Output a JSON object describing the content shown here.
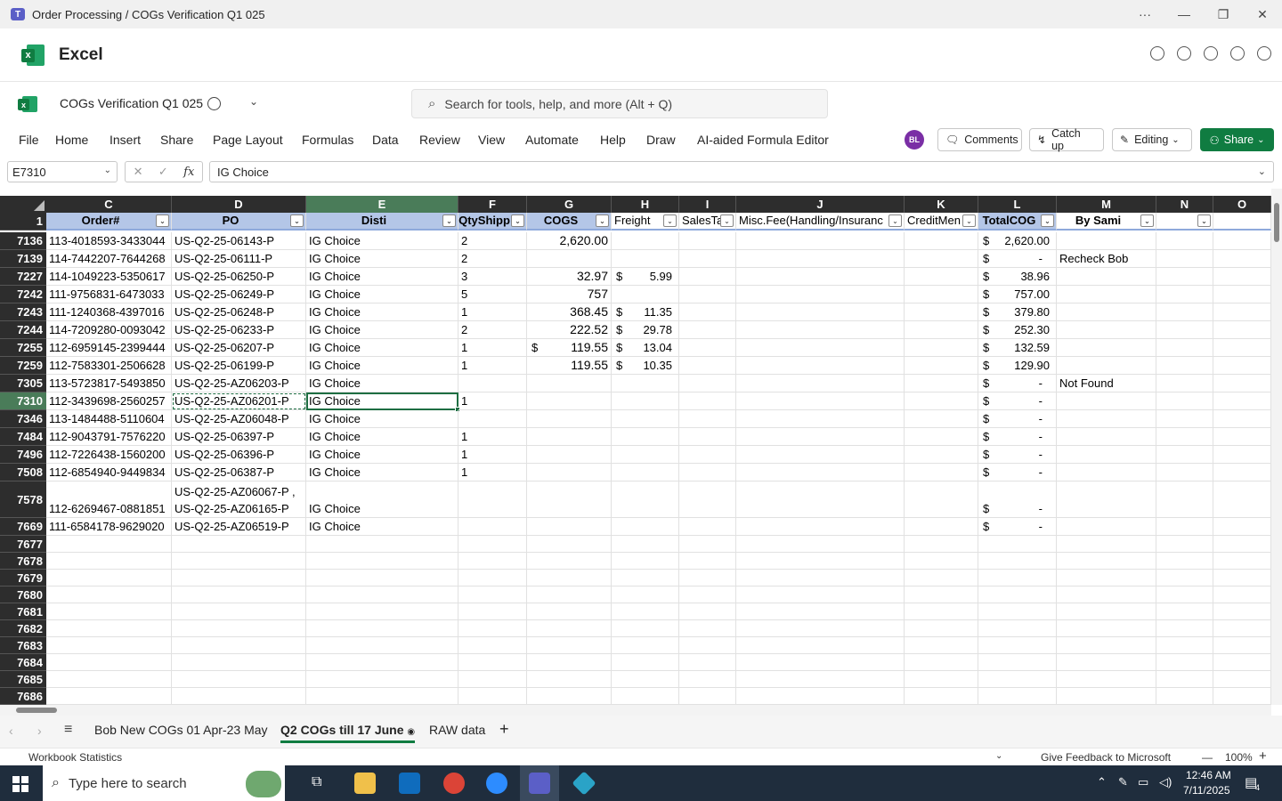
{
  "window": {
    "title": "Order Processing / COGs Verification Q1 025"
  },
  "app": {
    "name": "Excel"
  },
  "file": {
    "name": "COGs Verification Q1 025"
  },
  "search": {
    "placeholder": "Search for tools, help, and more (Alt + Q)"
  },
  "ribbon": {
    "tabs": [
      "File",
      "Home",
      "Insert",
      "Share",
      "Page Layout",
      "Formulas",
      "Data",
      "Review",
      "View",
      "Automate",
      "Help",
      "Draw",
      "AI-aided Formula Editor"
    ],
    "avatar": "BL",
    "comments": "Comments",
    "catchup": "Catch up",
    "editing": "Editing",
    "share": "Share"
  },
  "formula_bar": {
    "name_box": "E7310",
    "value": "IG Choice"
  },
  "columns": [
    "C",
    "D",
    "E",
    "F",
    "G",
    "H",
    "I",
    "J",
    "K",
    "L",
    "M",
    "N",
    "O"
  ],
  "header_row": {
    "row_num": "1",
    "cells": [
      "Order#",
      "PO",
      "Disti",
      "QtyShipp",
      "COGS",
      "Freight",
      "SalesTa",
      "Misc.Fee(Handling/Insuranc",
      "CreditMen",
      "TotalCOG",
      "By Sami",
      "",
      ""
    ]
  },
  "rows": [
    {
      "num": "7136",
      "C": "113-4018593-3433044",
      "D": "US-Q2-25-06143-P",
      "E": "IG Choice",
      "F": "2",
      "G": "2,620.00",
      "G_dollar": "",
      "H": "",
      "L": "2,620.00",
      "M": ""
    },
    {
      "num": "7139",
      "C": "114-7442207-7644268",
      "D": "US-Q2-25-06111-P",
      "E": "IG Choice",
      "F": "2",
      "G": "",
      "G_dollar": "",
      "H": "",
      "L": "-",
      "M": "Recheck Bob"
    },
    {
      "num": "7227",
      "C": "114-1049223-5350617",
      "D": "US-Q2-25-06250-P",
      "E": "IG Choice",
      "F": "3",
      "G": "32.97",
      "G_dollar": "",
      "H": "5.99",
      "L": "38.96",
      "M": ""
    },
    {
      "num": "7242",
      "C": "111-9756831-6473033",
      "D": "US-Q2-25-06249-P",
      "E": "IG Choice",
      "F": "5",
      "G": "757",
      "G_dollar": "",
      "H": "",
      "L": "757.00",
      "M": ""
    },
    {
      "num": "7243",
      "C": "111-1240368-4397016",
      "D": "US-Q2-25-06248-P",
      "E": "IG Choice",
      "F": "1",
      "G": "368.45",
      "G_dollar": "",
      "H": "11.35",
      "L": "379.80",
      "M": ""
    },
    {
      "num": "7244",
      "C": "114-7209280-0093042",
      "D": "US-Q2-25-06233-P",
      "E": "IG Choice",
      "F": "2",
      "G": "222.52",
      "G_dollar": "",
      "H": "29.78",
      "L": "252.30",
      "M": ""
    },
    {
      "num": "7255",
      "C": "112-6959145-2399444",
      "D": "US-Q2-25-06207-P",
      "E": "IG Choice",
      "F": "1",
      "G": "119.55",
      "G_dollar": "$",
      "H": "13.04",
      "L": "132.59",
      "M": ""
    },
    {
      "num": "7259",
      "C": "112-7583301-2506628",
      "D": "US-Q2-25-06199-P",
      "E": "IG Choice",
      "F": "1",
      "G": "119.55",
      "G_dollar": "",
      "H": "10.35",
      "L": "129.90",
      "M": ""
    },
    {
      "num": "7305",
      "C": "113-5723817-5493850",
      "D": "US-Q2-25-AZ06203-P",
      "E": "IG Choice",
      "F": "",
      "G": "",
      "G_dollar": "",
      "H": "",
      "L": "-",
      "M": "Not Found"
    },
    {
      "num": "7310",
      "C": "112-3439698-2560257",
      "D": "US-Q2-25-AZ06201-P",
      "E": "IG Choice",
      "F": "1",
      "G": "",
      "G_dollar": "",
      "H": "",
      "L": "-",
      "M": ""
    },
    {
      "num": "7346",
      "C": "113-1484488-5110604",
      "D": "US-Q2-25-AZ06048-P",
      "E": "IG Choice",
      "F": "",
      "G": "",
      "G_dollar": "",
      "H": "",
      "L": "-",
      "M": ""
    },
    {
      "num": "7484",
      "C": "112-9043791-7576220",
      "D": "US-Q2-25-06397-P",
      "E": "IG Choice",
      "F": "1",
      "G": "",
      "G_dollar": "",
      "H": "",
      "L": "-",
      "M": ""
    },
    {
      "num": "7496",
      "C": "112-7226438-1560200",
      "D": "US-Q2-25-06396-P",
      "E": "IG Choice",
      "F": "1",
      "G": "",
      "G_dollar": "",
      "H": "",
      "L": "-",
      "M": ""
    },
    {
      "num": "7508",
      "C": "112-6854940-9449834",
      "D": "US-Q2-25-06387-P",
      "E": "IG Choice",
      "F": "1",
      "G": "",
      "G_dollar": "",
      "H": "",
      "L": "-",
      "M": ""
    },
    {
      "num": "7578",
      "C": "112-6269467-0881851",
      "D": "US-Q2-25-AZ06067-P ,",
      "D2": "US-Q2-25-AZ06165-P",
      "E": "IG Choice",
      "F": "",
      "G": "",
      "G_dollar": "",
      "H": "",
      "L": "-",
      "M": ""
    },
    {
      "num": "7669",
      "C": "111-6584178-9629020",
      "D": "US-Q2-25-AZ06519-P",
      "E": "IG Choice",
      "F": "",
      "G": "",
      "G_dollar": "",
      "H": "",
      "L": "-",
      "M": ""
    }
  ],
  "empty_rows": [
    "7677",
    "7678",
    "7679",
    "7680",
    "7681",
    "7682",
    "7683",
    "7684",
    "7685",
    "7686"
  ],
  "sheets": {
    "tabs": [
      "Bob New COGs 01 Apr-23 May",
      "Q2 COGs till 17 June",
      "RAW data"
    ],
    "active_index": 1
  },
  "status": {
    "left": "Workbook Statistics",
    "feedback": "Give Feedback to Microsoft",
    "zoom": "100%"
  },
  "taskbar": {
    "search_placeholder": "Type here to search",
    "time": "12:46 AM",
    "date": "7/11/2025",
    "notifications": "4"
  },
  "colors": {
    "excel_green": "#107c41",
    "header_fill": "#b4c6e7",
    "grid_header_dark": "#2d2d2d",
    "selected_header": "#4a7c59"
  }
}
